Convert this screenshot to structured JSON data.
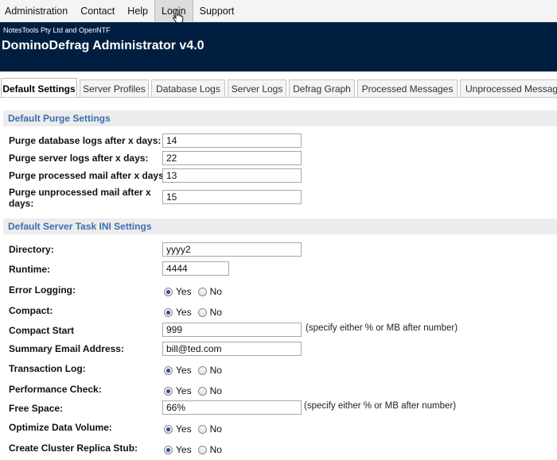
{
  "menu": {
    "items": [
      {
        "label": "Administration"
      },
      {
        "label": "Contact"
      },
      {
        "label": "Help"
      },
      {
        "label": "Login"
      },
      {
        "label": "Support"
      }
    ],
    "active": "Login"
  },
  "header": {
    "company": "NotesTools Pty Ltd and OpenNTF",
    "title": "DominoDefrag Administrator v4.0"
  },
  "tabs": [
    {
      "label": "Default Settings",
      "active": true
    },
    {
      "label": "Server Profiles"
    },
    {
      "label": "Database Logs"
    },
    {
      "label": "Server Logs"
    },
    {
      "label": "Defrag Graph"
    },
    {
      "label": "Processed Messages"
    },
    {
      "label": "Unprocessed Messages"
    }
  ],
  "purge": {
    "heading": "Default Purge Settings",
    "db_logs": {
      "label": "Purge database logs after x days:",
      "value": "14"
    },
    "server_logs": {
      "label": "Purge server logs after x days:",
      "value": "22"
    },
    "processed_mail": {
      "label": "Purge processed mail after x days:",
      "value": "13"
    },
    "unprocessed_mail": {
      "label_line1": "Purge unprocessed mail after x",
      "label_line2": "days:",
      "value": "15"
    }
  },
  "ini": {
    "heading": "Default Server Task INI Settings",
    "directory": {
      "label": "Directory:",
      "value": "yyyy2"
    },
    "runtime": {
      "label": "Runtime:",
      "value": "4444"
    },
    "error_logging": {
      "label": "Error Logging:",
      "selected": "Yes"
    },
    "compact": {
      "label": "Compact:",
      "selected": "Yes"
    },
    "compact_start": {
      "label": "Compact Start",
      "value": "999",
      "hint": "(specify either % or MB after number)"
    },
    "summary_email": {
      "label": "Summary Email Address:",
      "value": "bill@ted.com"
    },
    "transaction_log": {
      "label": "Transaction Log:",
      "selected": "Yes"
    },
    "performance_check": {
      "label": "Performance Check:",
      "selected": "Yes"
    },
    "free_space": {
      "label": "Free Space:",
      "value": "66%",
      "hint": "(specify either % or MB after number)"
    },
    "optimize_volume": {
      "label": "Optimize Data Volume:",
      "selected": "Yes"
    },
    "cluster_stub": {
      "label": "Create Cluster Replica Stub:",
      "selected": "Yes"
    }
  },
  "radio_options": {
    "yes": "Yes",
    "no": "No"
  }
}
